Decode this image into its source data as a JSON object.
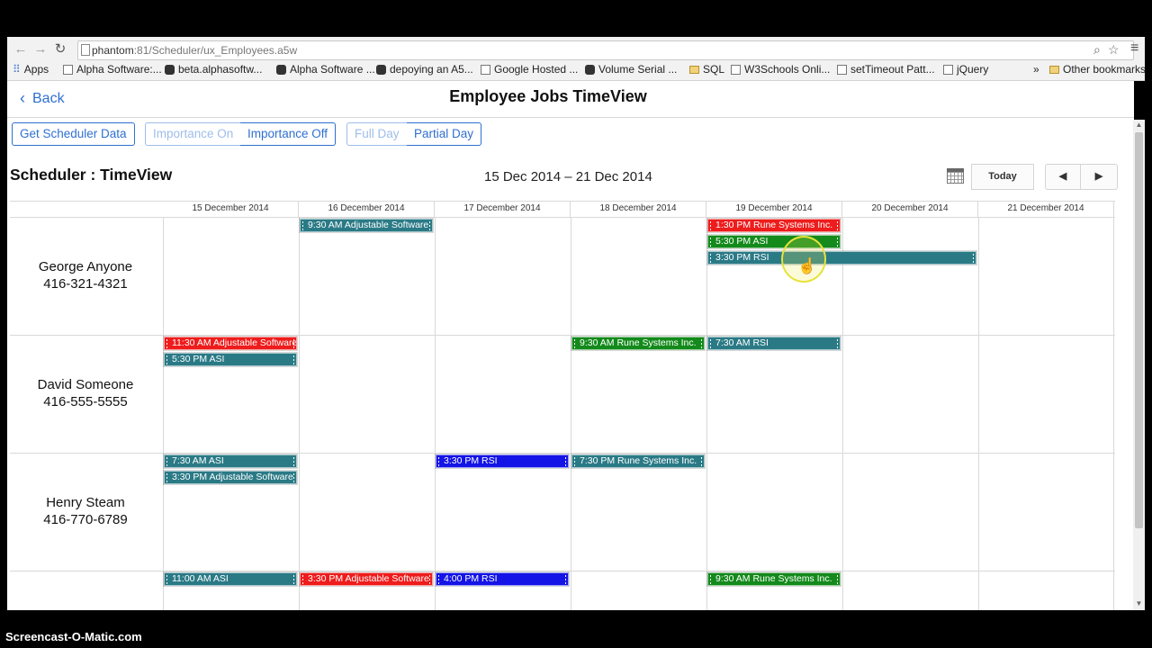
{
  "browser": {
    "url_host": "phantom",
    "url_rest": ":81/Scheduler/ux_Employees.a5w",
    "bookmarks": [
      {
        "label": "Apps",
        "icon": "apps-grid-icon"
      },
      {
        "label": "Alpha Software:...",
        "icon": "page-icon"
      },
      {
        "label": "beta.alphasoftw...",
        "icon": "page-icon"
      },
      {
        "label": "Alpha Software ...",
        "icon": "alpha-icon"
      },
      {
        "label": "depoying an A5...",
        "icon": "alpha-icon"
      },
      {
        "label": "Google Hosted ...",
        "icon": "google-icon"
      },
      {
        "label": "Volume Serial ...",
        "icon": "alpha-icon"
      },
      {
        "label": "SQL",
        "icon": "folder-icon"
      },
      {
        "label": "W3Schools Onli...",
        "icon": "w3schools-icon"
      },
      {
        "label": "setTimeout Patt...",
        "icon": "page-icon"
      },
      {
        "label": "jQuery",
        "icon": "jquery-icon"
      },
      {
        "label": "Other bookmarks",
        "icon": "folder-icon"
      }
    ],
    "overflow": "»"
  },
  "header": {
    "back_label": "Back",
    "title": "Employee Jobs TimeView"
  },
  "toolbar": {
    "get_data": "Get Scheduler Data",
    "importance_on": "Importance On",
    "importance_off": "Importance Off",
    "full_day": "Full Day",
    "partial_day": "Partial Day"
  },
  "scheduler": {
    "title": "Scheduler : TimeView",
    "range": "15 Dec 2014 – 21 Dec 2014",
    "today": "Today",
    "prev": "◀",
    "next": "▶",
    "days": [
      "15 December 2014",
      "16 December 2014",
      "17 December 2014",
      "18 December 2014",
      "19 December 2014",
      "20 December 2014",
      "21 December 2014"
    ],
    "employees": [
      {
        "name": "George Anyone",
        "phone": "416-321-4321"
      },
      {
        "name": "David Someone",
        "phone": "416-555-5555"
      },
      {
        "name": "Henry Steam",
        "phone": "416-770-6789"
      }
    ],
    "events": [
      {
        "row": 0,
        "day": 1,
        "slot": 0,
        "span": 1,
        "color": "teal",
        "label": "9:30 AM Adjustable Software"
      },
      {
        "row": 0,
        "day": 4,
        "slot": 0,
        "span": 1,
        "color": "red",
        "label": "1:30 PM Rune Systems Inc."
      },
      {
        "row": 0,
        "day": 4,
        "slot": 1,
        "span": 1,
        "color": "green",
        "label": "5:30 PM ASI"
      },
      {
        "row": 0,
        "day": 4,
        "slot": 2,
        "span": 2,
        "color": "teal",
        "label": "3:30 PM RSI"
      },
      {
        "row": 1,
        "day": 0,
        "slot": 0,
        "span": 1,
        "color": "red",
        "label": "11:30 AM Adjustable Software"
      },
      {
        "row": 1,
        "day": 0,
        "slot": 1,
        "span": 1,
        "color": "teal",
        "label": "5:30 PM ASI"
      },
      {
        "row": 1,
        "day": 3,
        "slot": 0,
        "span": 1,
        "color": "green",
        "label": "9:30 AM Rune Systems Inc."
      },
      {
        "row": 1,
        "day": 4,
        "slot": 0,
        "span": 1,
        "color": "teal",
        "label": "7:30 AM RSI"
      },
      {
        "row": 2,
        "day": 0,
        "slot": 0,
        "span": 1,
        "color": "teal",
        "label": "7:30 AM ASI"
      },
      {
        "row": 2,
        "day": 0,
        "slot": 1,
        "span": 1,
        "color": "teal",
        "label": "3:30 PM Adjustable Software"
      },
      {
        "row": 2,
        "day": 2,
        "slot": 0,
        "span": 1,
        "color": "blue",
        "label": "3:30 PM RSI"
      },
      {
        "row": 2,
        "day": 3,
        "slot": 0,
        "span": 1,
        "color": "teal",
        "label": "7:30 PM Rune Systems Inc."
      },
      {
        "row": 3,
        "day": 0,
        "slot": 0,
        "span": 1,
        "color": "teal",
        "label": "11:00 AM ASI"
      },
      {
        "row": 3,
        "day": 1,
        "slot": 0,
        "span": 1,
        "color": "red",
        "label": "3:30 PM Adjustable Software"
      },
      {
        "row": 3,
        "day": 2,
        "slot": 0,
        "span": 1,
        "color": "blue",
        "label": "4:00 PM RSI"
      },
      {
        "row": 3,
        "day": 4,
        "slot": 0,
        "span": 1,
        "color": "green",
        "label": "9:30 AM Rune Systems Inc."
      }
    ]
  },
  "watermark": "Screencast-O-Matic.com"
}
